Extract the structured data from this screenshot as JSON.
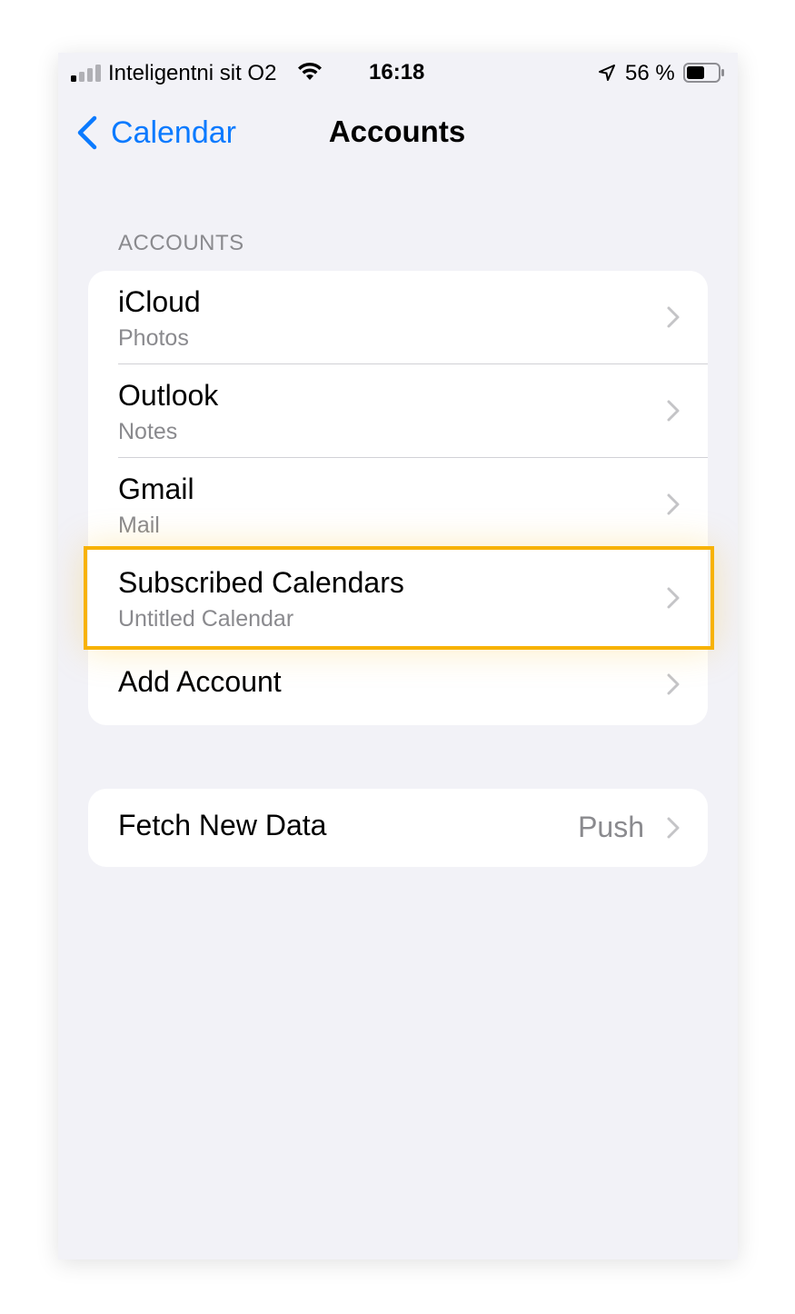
{
  "status_bar": {
    "carrier": "Inteligentni sit O2",
    "time": "16:18",
    "battery_percent": "56 %"
  },
  "nav": {
    "back_label": "Calendar",
    "title": "Accounts"
  },
  "accounts_section": {
    "header": "ACCOUNTS",
    "items": [
      {
        "label": "iCloud",
        "sub": "Photos"
      },
      {
        "label": "Outlook",
        "sub": "Notes"
      },
      {
        "label": "Gmail",
        "sub": "Mail"
      },
      {
        "label": "Subscribed Calendars",
        "sub": "Untitled Calendar"
      }
    ],
    "add_account": "Add Account"
  },
  "fetch": {
    "label": "Fetch New Data",
    "value": "Push"
  },
  "colors": {
    "accent": "#0a7aff",
    "highlight": "#f7b203",
    "background": "#f2f2f7"
  }
}
